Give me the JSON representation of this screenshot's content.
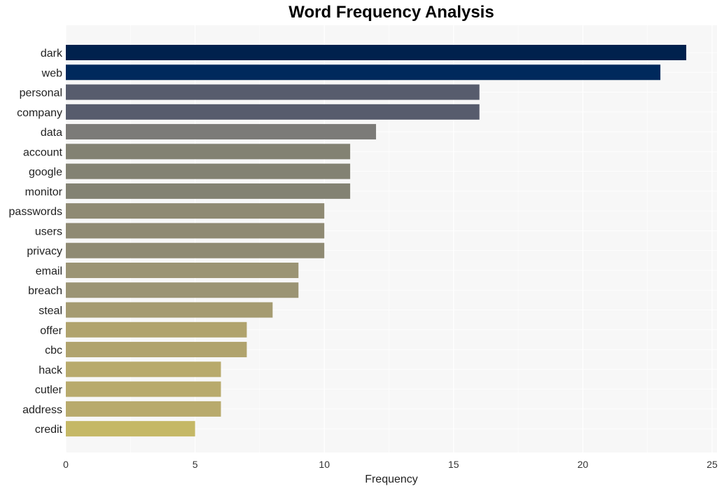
{
  "chart_data": {
    "type": "bar",
    "orientation": "horizontal",
    "title": "Word Frequency Analysis",
    "xlabel": "Frequency",
    "ylabel": "",
    "xlim": [
      0,
      25
    ],
    "xticks": [
      0,
      5,
      10,
      15,
      20,
      25
    ],
    "grid": true,
    "categories": [
      "dark",
      "web",
      "personal",
      "company",
      "data",
      "account",
      "google",
      "monitor",
      "passwords",
      "users",
      "privacy",
      "email",
      "breach",
      "steal",
      "offer",
      "cbc",
      "hack",
      "cutler",
      "address",
      "credit"
    ],
    "values": [
      24,
      23,
      16,
      16,
      12,
      11,
      11,
      11,
      10,
      10,
      10,
      9,
      9,
      8,
      7,
      7,
      6,
      6,
      6,
      5
    ],
    "colors": [
      "#00214d",
      "#00295c",
      "#575c6d",
      "#575c6d",
      "#7c7b78",
      "#838273",
      "#838273",
      "#838273",
      "#8f8a73",
      "#8f8a73",
      "#8f8a73",
      "#9b9474",
      "#9b9474",
      "#a59b71",
      "#b0a36d",
      "#b0a36d",
      "#b8aa6c",
      "#b8aa6c",
      "#b8aa6c",
      "#c5b866"
    ]
  },
  "style": {
    "plot_background": "#f7f7f7",
    "grid_color": "#ffffff"
  }
}
